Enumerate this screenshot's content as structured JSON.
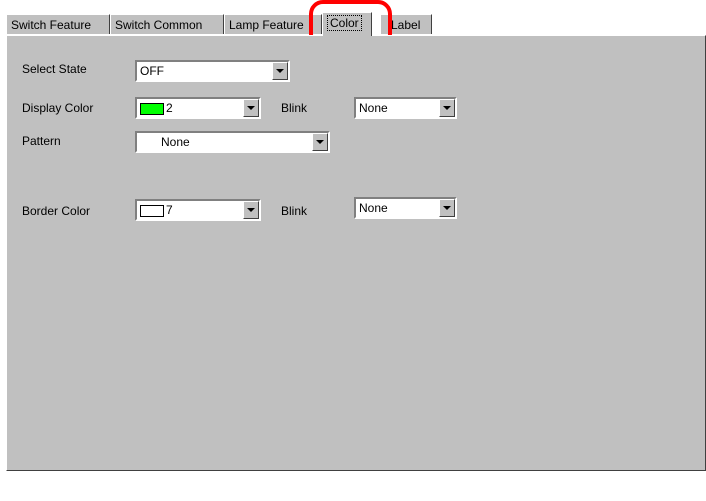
{
  "tabs": [
    {
      "label": "Switch Feature"
    },
    {
      "label": "Switch Common"
    },
    {
      "label": "Lamp Feature"
    },
    {
      "label": "Color",
      "active": true
    },
    {
      "label": "Label"
    }
  ],
  "form": {
    "select_state": {
      "label": "Select State",
      "value": "OFF"
    },
    "display_color": {
      "label": "Display Color",
      "value": "2",
      "swatch_color": "#00ff00"
    },
    "display_blink": {
      "label": "Blink",
      "value": "None"
    },
    "pattern": {
      "label": "Pattern",
      "value": "None"
    },
    "border_color": {
      "label": "Border Color",
      "value": "7",
      "swatch_color": "#ffffff"
    },
    "border_blink": {
      "label": "Blink",
      "value": "None"
    }
  },
  "annotation": {
    "highlight_color": "#ff0000"
  }
}
